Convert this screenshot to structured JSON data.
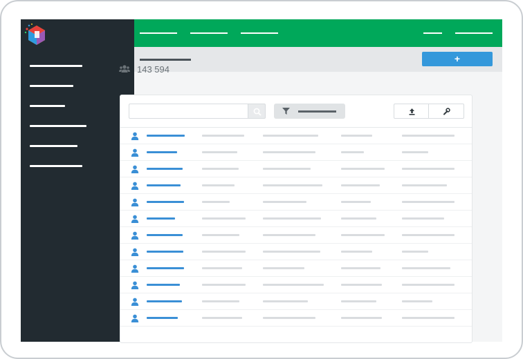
{
  "summary": {
    "user_count": "143 594",
    "count_icon": "users-icon"
  },
  "header": {
    "add_label": "+"
  },
  "icons": {
    "logo": "app-logo",
    "search": "search-icon",
    "filter": "filter-icon",
    "export": "upload-icon",
    "settings": "wrench-icon",
    "row": "user-icon"
  },
  "colors": {
    "sidebar": "#222b31",
    "topbar": "#00a85a",
    "accent": "#3498db",
    "link": "#3a8fd6"
  }
}
